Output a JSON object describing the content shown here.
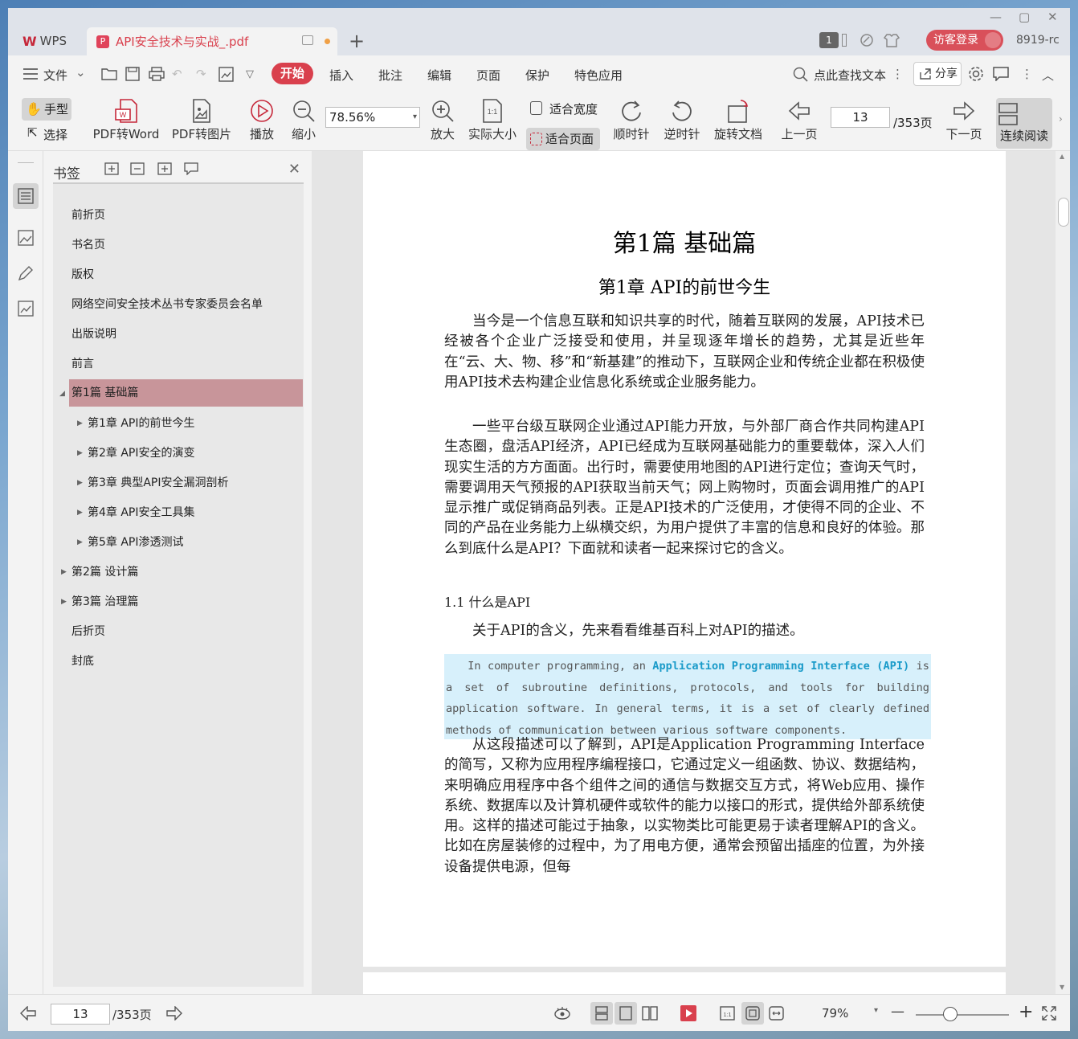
{
  "titlebar": {
    "app_name": "WPS",
    "doc_tab_title": "API安全技术与实战_.pdf",
    "add_tab": "+",
    "badge_count": "1",
    "login_label": "访客登录",
    "user_id": "8919-rc"
  },
  "menubar": {
    "file_label": "文件",
    "items": [
      "开始",
      "插入",
      "批注",
      "编辑",
      "页面",
      "保护",
      "特色应用"
    ],
    "search_label": "点此查找文本",
    "share_label": "分享"
  },
  "toolbar": {
    "hand": "手型",
    "select": "选择",
    "pdf_to_word": "PDF转Word",
    "pdf_to_image": "PDF转图片",
    "play": "播放",
    "zoom_out": "缩小",
    "zoom_value": "78.56%",
    "zoom_in": "放大",
    "actual_size": "实际大小",
    "fit_width": "适合宽度",
    "fit_page": "适合页面",
    "rotate_cw": "顺时针",
    "rotate_ccw": "逆时针",
    "rotate_doc": "旋转文档",
    "prev_page": "上一页",
    "page_number": "13",
    "page_total": "/353页",
    "next_page": "下一页",
    "continuous_read": "连续阅读"
  },
  "bookmarks": {
    "title": "书签",
    "items": [
      {
        "label": "前折页"
      },
      {
        "label": "书名页"
      },
      {
        "label": "版权"
      },
      {
        "label": "网络空间安全技术丛书专家委员会名单"
      },
      {
        "label": "出版说明"
      },
      {
        "label": "前言"
      },
      {
        "label": "第1篇 基础篇"
      },
      {
        "label": "第1章 API的前世今生"
      },
      {
        "label": "第2章 API安全的演变"
      },
      {
        "label": "第3章 典型API安全漏洞剖析"
      },
      {
        "label": "第4章 API安全工具集"
      },
      {
        "label": "第5章 API渗透测试"
      },
      {
        "label": "第2篇 设计篇"
      },
      {
        "label": "第3篇 治理篇"
      },
      {
        "label": "后折页"
      },
      {
        "label": "封底"
      }
    ]
  },
  "document": {
    "part_title": "第1篇  基础篇",
    "chapter_title": "第1章  API的前世今生",
    "para1": "当今是一个信息互联和知识共享的时代，随着互联网的发展，API技术已经被各个企业广泛接受和使用，并呈现逐年增长的趋势，尤其是近些年在“云、大、物、移”和“新基建”的推动下，互联网企业和传统企业都在积极使用API技术去构建企业信息化系统或企业服务能力。",
    "para2": "一些平台级互联网企业通过API能力开放，与外部厂商合作共同构建API生态圈，盘活API经济，API已经成为互联网基础能力的重要载体，深入人们现实生活的方方面面。出行时，需要使用地图的API进行定位；查询天气时，需要调用天气预报的API获取当前天气；网上购物时，页面会调用推广的API显示推广或促销商品列表。正是API技术的广泛使用，才使得不同的企业、不同的产品在业务能力上纵横交织，为用户提供了丰富的信息和良好的体验。那么到底什么是API？下面就和读者一起来探讨它的含义。",
    "section_title": "1.1  什么是API",
    "para3": "关于API的含义，先来看看维基百科上对API的描述。",
    "quote_pre": "In computer programming, an ",
    "quote_highlight": "Application Programming Interface (API)",
    "quote_post": " is a set of subroutine definitions, protocols, and tools for building application software. In general terms, it is a set of clearly defined methods of communication between various software components.",
    "para4": "从这段描述可以了解到，API是Application Programming Interface的简写，又称为应用程序编程接口，它通过定义一组函数、协议、数据结构，来明确应用程序中各个组件之间的通信与数据交互方式，将Web应用、操作系统、数据库以及计算机硬件或软件的能力以接口的形式，提供给外部系统使用。这样的描述可能过于抽象，以实物类比可能更易于读者理解API的含义。比如在房屋装修的过程中，为了用电方便，通常会预留出插座的位置，为外接设备提供电源，但每"
  },
  "statusbar": {
    "page_number": "13",
    "page_total": "/353页",
    "zoom_percent": "79%",
    "zoom_minus": "—",
    "zoom_plus": "+"
  },
  "colors": {
    "accent": "#d9404d",
    "bookmark_selected": "#c8959a",
    "quote_bg": "#d7f0fb",
    "quote_highlight": "#1a9bc9"
  }
}
